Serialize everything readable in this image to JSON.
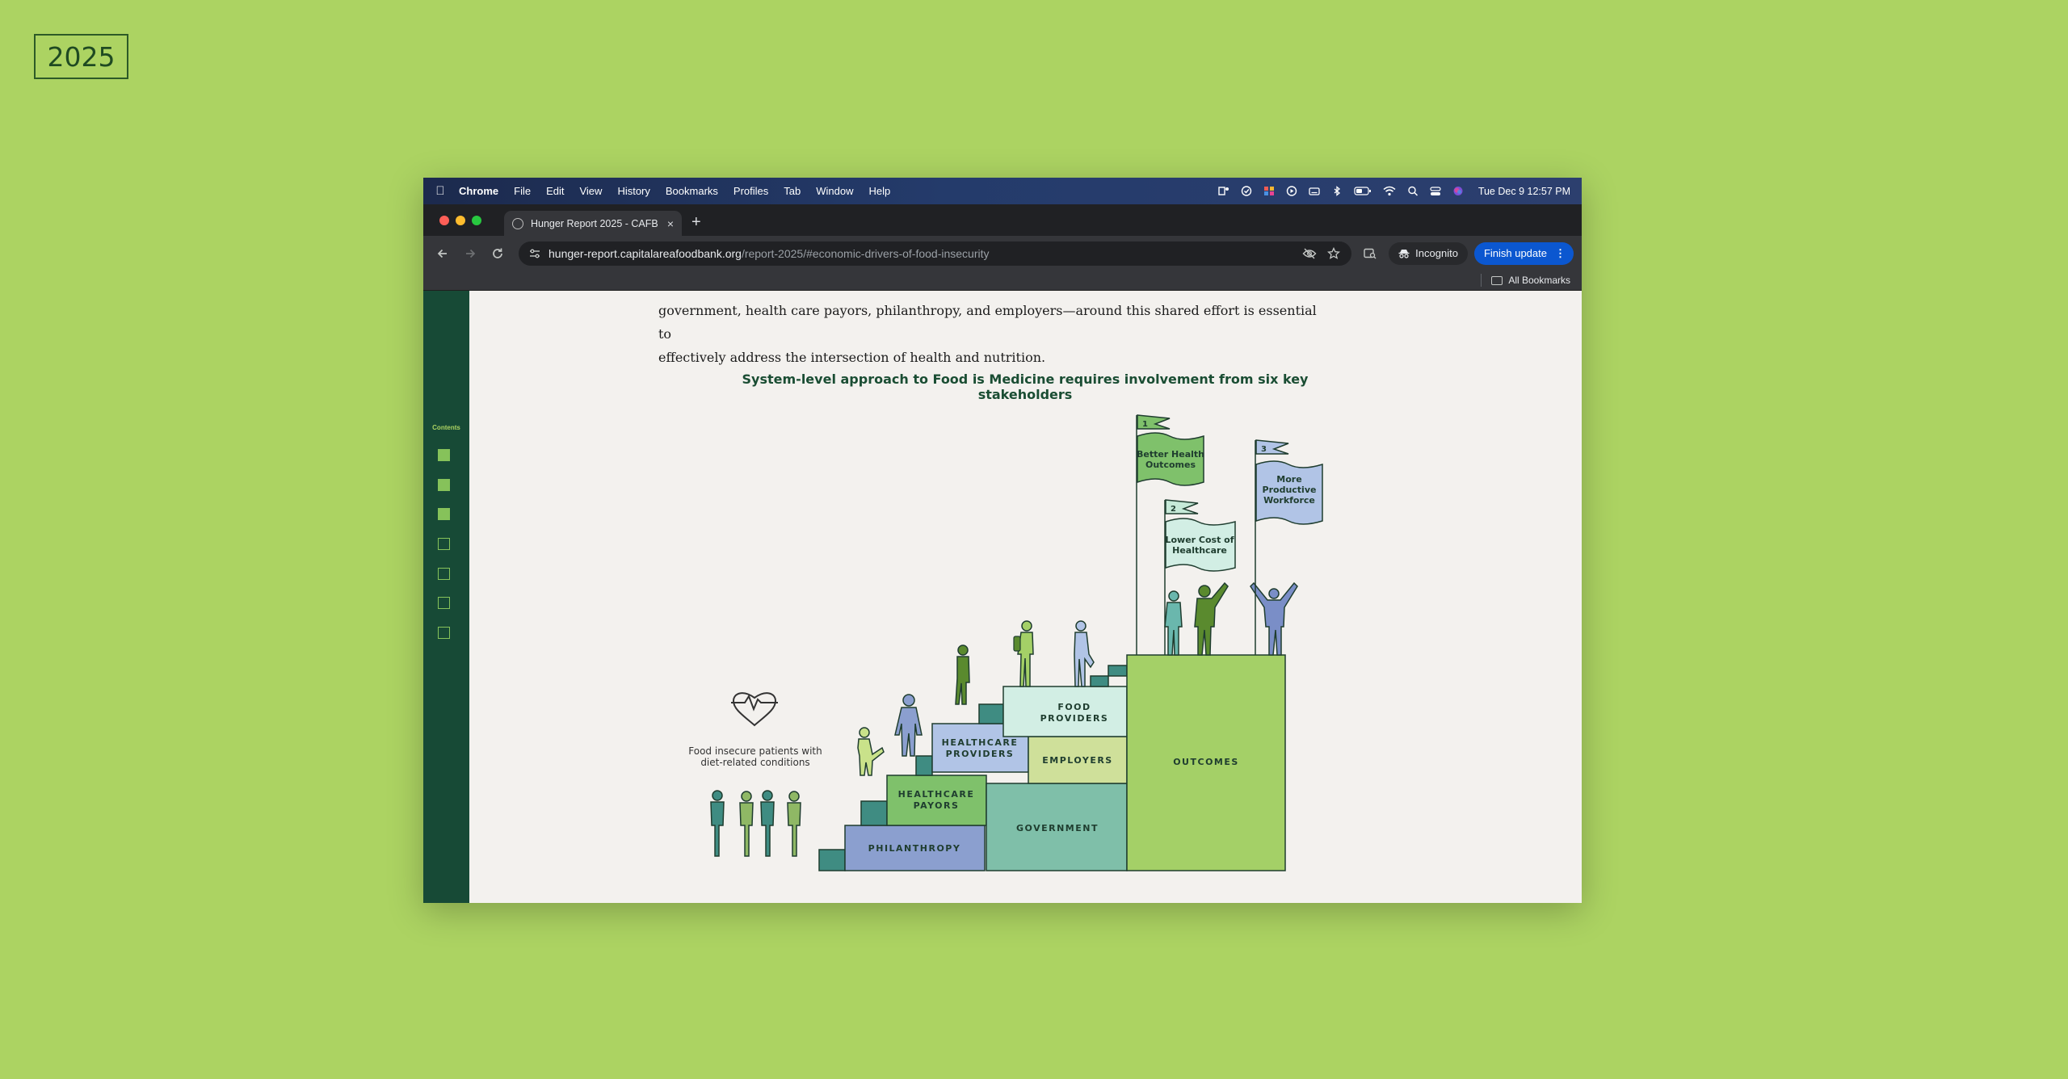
{
  "badge": {
    "year": "2025"
  },
  "menubar": {
    "items": [
      "Chrome",
      "File",
      "Edit",
      "View",
      "History",
      "Bookmarks",
      "Profiles",
      "Tab",
      "Window",
      "Help"
    ],
    "clock": "Tue Dec 9  12:57 PM"
  },
  "tab": {
    "title": "Hunger Report 2025 - CAFB",
    "close": "×",
    "new_tab": "+"
  },
  "omnibox": {
    "host": "hunger-report.capitalareafoodbank.org",
    "path": "/report-2025/#economic-drivers-of-food-insecurity"
  },
  "toolbar": {
    "incognito": "Incognito",
    "finish_update": "Finish update"
  },
  "bookmarks": {
    "all": "All Bookmarks"
  },
  "sidebar": {
    "label": "Contents"
  },
  "article": {
    "body_line1": "government, health care payors, philanthropy, and employers—around this shared effort is essential to",
    "body_line2": "effectively address the intersection of health and nutrition.",
    "figure_title": "System-level approach to Food is Medicine requires involvement from six key stakeholders"
  },
  "illustration": {
    "patients_caption_1": "Food insecure patients with",
    "patients_caption_2": "diet-related conditions",
    "blocks": {
      "philanthropy": "PHILANTHROPY",
      "healthcare_payors_1": "HEALTHCARE",
      "healthcare_payors_2": "PAYORS",
      "healthcare_providers_1": "HEALTHCARE",
      "healthcare_providers_2": "PROVIDERS",
      "government": "GOVERNMENT",
      "employers": "EMPLOYERS",
      "food_providers_1": "FOOD",
      "food_providers_2": "PROVIDERS",
      "outcomes": "OUTCOMES"
    },
    "flags": {
      "f1_num": "1",
      "f1_line1": "Better Health",
      "f1_line2": "Outcomes",
      "f2_num": "2",
      "f2_line1": "Lower Cost of",
      "f2_line2": "Healthcare",
      "f3_num": "3",
      "f3_line1": "More",
      "f3_line2": "Productive",
      "f3_line3": "Workforce"
    }
  },
  "colors": {
    "background": "#acd362",
    "sidebar": "#174a36",
    "accent_green": "#86c25a",
    "chrome_blue": "#0b57d0"
  }
}
